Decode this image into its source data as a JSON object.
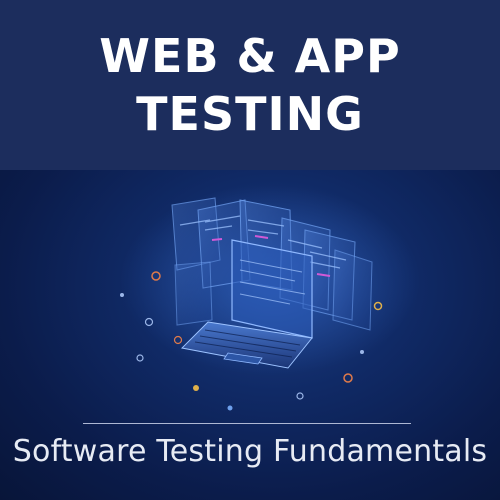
{
  "header": {
    "title_line_1": "WEB & APP",
    "title_line_2": "TESTING"
  },
  "hero": {
    "illustration": "laptop-with-floating-screens-icon",
    "caption": "Software Testing Fundamentals"
  },
  "colors": {
    "header_bg": "#1c2d5d",
    "hero_bg": "#102a66",
    "title_text": "#ffffff",
    "caption_text": "#e7ebf4"
  }
}
